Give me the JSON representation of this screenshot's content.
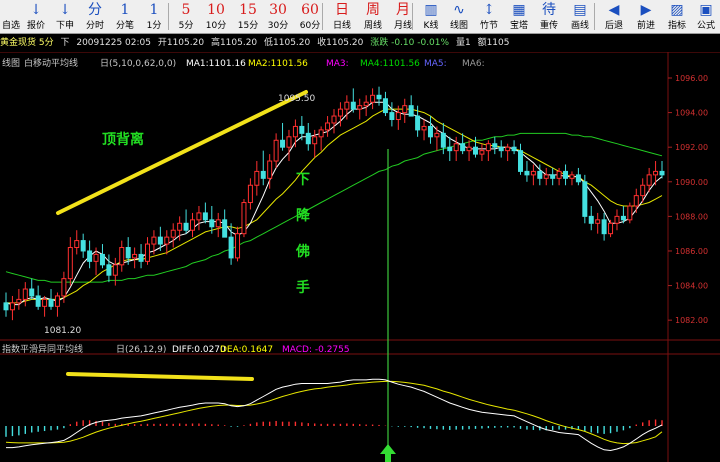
{
  "toolbar": {
    "items": [
      {
        "glyph": "",
        "label": "自选"
      },
      {
        "glyph": "↓",
        "label": "报价"
      },
      {
        "glyph": "↓",
        "label": "下申"
      },
      {
        "glyph": "分",
        "label": "分时"
      },
      {
        "glyph": "1",
        "label": "分笔"
      },
      {
        "glyph": "1",
        "label": "1分"
      },
      {
        "glyph": "5",
        "label": "5分"
      },
      {
        "glyph": "10",
        "label": "10分"
      },
      {
        "glyph": "15",
        "label": "15分"
      },
      {
        "glyph": "30",
        "label": "30分"
      },
      {
        "glyph": "60",
        "label": "60分"
      },
      {
        "glyph": "日",
        "label": "日线"
      },
      {
        "glyph": "周",
        "label": "周线"
      },
      {
        "glyph": "月",
        "label": "月线"
      },
      {
        "glyph": "▥",
        "label": "K线"
      },
      {
        "glyph": "∿",
        "label": "线图"
      },
      {
        "glyph": "↕",
        "label": "竹节"
      },
      {
        "glyph": "▦",
        "label": "宝塔"
      },
      {
        "glyph": "待",
        "label": "重传"
      },
      {
        "glyph": "▤",
        "label": "画线"
      },
      {
        "glyph": "◀",
        "label": "后退"
      },
      {
        "glyph": "▶",
        "label": "前进"
      },
      {
        "glyph": "▨",
        "label": "指标"
      },
      {
        "glyph": "▣",
        "label": "公式"
      }
    ]
  },
  "quote": {
    "name": "黄金现货 5分",
    "direction": "下",
    "time": "20091225 02:05",
    "open": "开1105.20",
    "high": "高1105.20",
    "low": "低1105.20",
    "close": "收1105.20",
    "change": "涨跌 -0.10 -0.01%",
    "volume": "量1",
    "amount": "额1105"
  },
  "legend_main": {
    "prefix": "线图",
    "name": "白移动平均线",
    "params": "日(5,10,0,62,0,0)",
    "ma1": "MA1:1101.16",
    "ma2": "MA2:1101.56",
    "ma3": "MA3:",
    "ma4": "MA4:1101.56",
    "ma5": "MA5:",
    "ma6": "MA6:"
  },
  "legend_macd": {
    "name": "指数平滑异同平均线",
    "params": "日(26,12,9)",
    "diff": "DIFF:0.0270",
    "dea": "DEA:0.1647",
    "macd": "MACD: -0.2755"
  },
  "annotations": {
    "top_divergence": "顶背离",
    "falling_hand": [
      "下",
      "降",
      "佛",
      "手"
    ],
    "high_label": "1095.50",
    "low_label": "1081.20"
  },
  "chart_data": {
    "type": "candlestick",
    "y_axis_labels": [
      "1096.00",
      "1094.00",
      "1092.00",
      "1090.00",
      "1088.00",
      "1086.00",
      "1084.00",
      "1082.00"
    ],
    "ylim": [
      1081.2,
      1096.0
    ],
    "ohlc": [
      [
        1083.0,
        1083.6,
        1082.2,
        1082.6
      ],
      [
        1082.6,
        1083.4,
        1082.0,
        1083.0
      ],
      [
        1083.0,
        1083.8,
        1082.6,
        1083.2
      ],
      [
        1083.2,
        1084.2,
        1082.8,
        1083.8
      ],
      [
        1083.8,
        1084.4,
        1083.2,
        1083.4
      ],
      [
        1083.4,
        1084.0,
        1082.6,
        1082.8
      ],
      [
        1082.8,
        1083.4,
        1082.2,
        1083.2
      ],
      [
        1083.2,
        1083.8,
        1082.6,
        1082.8
      ],
      [
        1082.8,
        1083.6,
        1082.2,
        1083.4
      ],
      [
        1083.4,
        1084.8,
        1083.0,
        1084.4
      ],
      [
        1084.4,
        1086.8,
        1084.0,
        1086.2
      ],
      [
        1086.2,
        1087.2,
        1085.8,
        1086.6
      ],
      [
        1086.6,
        1087.0,
        1085.6,
        1086.0
      ],
      [
        1086.0,
        1086.6,
        1085.0,
        1085.4
      ],
      [
        1085.4,
        1086.2,
        1084.6,
        1085.8
      ],
      [
        1085.8,
        1086.4,
        1085.0,
        1085.2
      ],
      [
        1085.2,
        1085.8,
        1084.2,
        1084.6
      ],
      [
        1084.6,
        1085.6,
        1084.0,
        1085.2
      ],
      [
        1085.2,
        1086.6,
        1084.8,
        1086.2
      ],
      [
        1086.2,
        1086.8,
        1085.2,
        1085.6
      ],
      [
        1085.6,
        1086.2,
        1085.0,
        1085.8
      ],
      [
        1085.8,
        1086.4,
        1085.0,
        1085.4
      ],
      [
        1085.4,
        1086.8,
        1085.2,
        1086.4
      ],
      [
        1086.4,
        1087.2,
        1085.8,
        1086.8
      ],
      [
        1086.8,
        1087.4,
        1086.0,
        1086.4
      ],
      [
        1086.4,
        1087.2,
        1085.8,
        1086.8
      ],
      [
        1086.8,
        1087.6,
        1086.2,
        1087.2
      ],
      [
        1087.2,
        1088.0,
        1086.6,
        1087.6
      ],
      [
        1087.6,
        1088.4,
        1087.0,
        1087.2
      ],
      [
        1087.2,
        1088.2,
        1086.8,
        1087.8
      ],
      [
        1087.8,
        1088.6,
        1087.2,
        1088.2
      ],
      [
        1088.2,
        1088.8,
        1087.6,
        1087.8
      ],
      [
        1087.8,
        1088.6,
        1087.0,
        1087.4
      ],
      [
        1087.4,
        1088.2,
        1086.8,
        1087.8
      ],
      [
        1087.8,
        1088.4,
        1087.0,
        1086.8
      ],
      [
        1086.8,
        1087.6,
        1085.2,
        1085.6
      ],
      [
        1085.6,
        1087.4,
        1085.4,
        1087.0
      ],
      [
        1087.0,
        1089.0,
        1086.8,
        1088.8
      ],
      [
        1088.8,
        1090.2,
        1088.4,
        1089.8
      ],
      [
        1089.8,
        1091.2,
        1089.2,
        1090.6
      ],
      [
        1090.6,
        1091.8,
        1089.8,
        1090.2
      ],
      [
        1090.2,
        1091.6,
        1089.6,
        1091.2
      ],
      [
        1091.2,
        1092.8,
        1090.8,
        1092.4
      ],
      [
        1092.4,
        1093.4,
        1091.8,
        1092.0
      ],
      [
        1092.0,
        1093.0,
        1091.2,
        1092.6
      ],
      [
        1092.6,
        1093.6,
        1092.0,
        1093.2
      ],
      [
        1093.2,
        1093.8,
        1092.4,
        1092.8
      ],
      [
        1092.8,
        1093.4,
        1091.8,
        1092.2
      ],
      [
        1092.2,
        1093.0,
        1091.4,
        1092.6
      ],
      [
        1092.6,
        1093.2,
        1091.8,
        1093.0
      ],
      [
        1093.0,
        1093.8,
        1092.6,
        1093.4
      ],
      [
        1093.4,
        1094.2,
        1092.8,
        1093.8
      ],
      [
        1093.8,
        1094.6,
        1093.2,
        1094.2
      ],
      [
        1094.2,
        1095.0,
        1093.6,
        1094.6
      ],
      [
        1094.6,
        1095.4,
        1094.0,
        1094.2
      ],
      [
        1094.2,
        1094.8,
        1093.6,
        1094.4
      ],
      [
        1094.4,
        1095.0,
        1093.8,
        1094.6
      ],
      [
        1094.6,
        1095.4,
        1094.2,
        1095.0
      ],
      [
        1095.0,
        1095.5,
        1094.4,
        1094.8
      ],
      [
        1094.8,
        1095.2,
        1093.8,
        1094.0
      ],
      [
        1094.0,
        1094.6,
        1093.2,
        1093.6
      ],
      [
        1093.6,
        1094.4,
        1093.0,
        1094.0
      ],
      [
        1094.0,
        1094.8,
        1093.4,
        1094.4
      ],
      [
        1094.4,
        1095.0,
        1093.8,
        1093.8
      ],
      [
        1093.8,
        1094.4,
        1092.6,
        1093.0
      ],
      [
        1093.0,
        1093.6,
        1092.4,
        1093.2
      ],
      [
        1093.2,
        1093.8,
        1092.2,
        1092.6
      ],
      [
        1092.6,
        1093.2,
        1091.8,
        1092.8
      ],
      [
        1092.8,
        1093.4,
        1091.6,
        1092.0
      ],
      [
        1092.0,
        1092.6,
        1091.2,
        1091.8
      ],
      [
        1091.8,
        1092.6,
        1091.2,
        1092.2
      ],
      [
        1092.2,
        1092.8,
        1091.6,
        1091.8
      ],
      [
        1091.8,
        1092.4,
        1091.2,
        1092.0
      ],
      [
        1092.0,
        1092.6,
        1091.4,
        1091.6
      ],
      [
        1091.6,
        1092.2,
        1091.2,
        1091.8
      ],
      [
        1091.8,
        1092.4,
        1091.2,
        1092.2
      ],
      [
        1092.2,
        1092.6,
        1091.6,
        1092.0
      ],
      [
        1092.0,
        1092.4,
        1091.4,
        1091.8
      ],
      [
        1091.8,
        1092.2,
        1091.2,
        1092.0
      ],
      [
        1092.0,
        1092.4,
        1091.6,
        1091.8
      ],
      [
        1091.8,
        1092.2,
        1090.4,
        1090.6
      ],
      [
        1090.6,
        1091.2,
        1090.0,
        1090.4
      ],
      [
        1090.4,
        1091.0,
        1089.8,
        1090.6
      ],
      [
        1090.6,
        1091.0,
        1089.8,
        1090.2
      ],
      [
        1090.2,
        1090.8,
        1089.8,
        1090.4
      ],
      [
        1090.4,
        1090.8,
        1089.8,
        1090.2
      ],
      [
        1090.2,
        1090.8,
        1089.8,
        1090.6
      ],
      [
        1090.6,
        1091.0,
        1089.8,
        1090.2
      ],
      [
        1090.2,
        1090.6,
        1089.8,
        1090.4
      ],
      [
        1090.4,
        1090.8,
        1089.8,
        1090.0
      ],
      [
        1090.0,
        1090.4,
        1087.6,
        1088.0
      ],
      [
        1088.0,
        1088.6,
        1087.2,
        1087.6
      ],
      [
        1087.6,
        1088.2,
        1087.0,
        1087.8
      ],
      [
        1087.8,
        1088.2,
        1086.6,
        1087.0
      ],
      [
        1087.0,
        1087.8,
        1086.8,
        1087.6
      ],
      [
        1087.6,
        1088.4,
        1087.2,
        1088.0
      ],
      [
        1088.0,
        1088.6,
        1087.6,
        1087.8
      ],
      [
        1087.8,
        1088.8,
        1087.6,
        1088.6
      ],
      [
        1088.6,
        1089.6,
        1088.2,
        1089.2
      ],
      [
        1089.2,
        1090.2,
        1088.8,
        1089.8
      ],
      [
        1089.8,
        1090.8,
        1089.4,
        1090.4
      ],
      [
        1090.4,
        1091.2,
        1089.8,
        1090.6
      ],
      [
        1090.6,
        1091.2,
        1090.2,
        1090.4
      ]
    ],
    "ma5": [
      1083.0,
      1082.9,
      1082.9,
      1083.2,
      1083.3,
      1083.2,
      1083.3,
      1083.2,
      1083.1,
      1083.3,
      1083.9,
      1084.6,
      1085.3,
      1085.7,
      1086.0,
      1085.8,
      1085.4,
      1085.2,
      1085.3,
      1085.4,
      1085.5,
      1085.6,
      1085.9,
      1086.0,
      1086.2,
      1086.4,
      1086.6,
      1086.9,
      1087.0,
      1087.3,
      1087.6,
      1087.7,
      1087.7,
      1087.7,
      1087.6,
      1087.1,
      1086.9,
      1087.1,
      1087.6,
      1088.4,
      1089.2,
      1090.1,
      1090.8,
      1091.3,
      1091.7,
      1092.3,
      1092.6,
      1092.6,
      1092.7,
      1092.8,
      1092.9,
      1093.2,
      1093.5,
      1093.9,
      1094.2,
      1094.2,
      1094.3,
      1094.6,
      1094.6,
      1094.6,
      1094.2,
      1094.0,
      1093.9,
      1093.9,
      1093.8,
      1093.6,
      1093.4,
      1093.0,
      1092.8,
      1092.5,
      1092.3,
      1092.1,
      1091.9,
      1091.9,
      1091.9,
      1091.9,
      1091.9,
      1092.0,
      1092.0,
      1091.9,
      1091.7,
      1091.4,
      1091.1,
      1090.7,
      1090.4,
      1090.4,
      1090.4,
      1090.3,
      1090.3,
      1090.3,
      1089.9,
      1089.4,
      1088.9,
      1088.3,
      1087.6,
      1087.6,
      1087.7,
      1087.9,
      1088.4,
      1088.9,
      1089.5,
      1090.0,
      1090.3
    ],
    "ma10": [
      1083.0,
      1083.0,
      1083.0,
      1083.1,
      1083.2,
      1083.2,
      1083.2,
      1083.2,
      1083.2,
      1083.3,
      1083.5,
      1083.7,
      1084.0,
      1084.2,
      1084.5,
      1084.8,
      1085.0,
      1085.2,
      1085.4,
      1085.5,
      1085.5,
      1085.5,
      1085.6,
      1085.7,
      1085.8,
      1085.9,
      1086.1,
      1086.3,
      1086.5,
      1086.7,
      1086.9,
      1087.1,
      1087.2,
      1087.3,
      1087.4,
      1087.4,
      1087.3,
      1087.4,
      1087.6,
      1087.8,
      1088.2,
      1088.6,
      1089.0,
      1089.3,
      1089.7,
      1090.1,
      1090.6,
      1091.0,
      1091.4,
      1091.7,
      1092.1,
      1092.4,
      1092.7,
      1092.9,
      1093.1,
      1093.3,
      1093.5,
      1093.8,
      1094.0,
      1094.2,
      1094.2,
      1094.2,
      1094.2,
      1094.2,
      1094.1,
      1094.0,
      1093.8,
      1093.5,
      1093.3,
      1093.1,
      1092.9,
      1092.7,
      1092.5,
      1092.3,
      1092.2,
      1092.1,
      1092.1,
      1092.0,
      1092.0,
      1091.9,
      1091.8,
      1091.6,
      1091.4,
      1091.2,
      1091.0,
      1090.8,
      1090.6,
      1090.4,
      1090.3,
      1090.3,
      1090.0,
      1089.8,
      1089.5,
      1089.2,
      1088.9,
      1088.7,
      1088.6,
      1088.6,
      1088.6,
      1088.7,
      1088.8,
      1089.0,
      1089.2
    ],
    "ma60": [
      1084.8,
      1084.7,
      1084.6,
      1084.5,
      1084.4,
      1084.3,
      1084.3,
      1084.2,
      1084.2,
      1084.2,
      1084.2,
      1084.2,
      1084.2,
      1084.2,
      1084.2,
      1084.2,
      1084.3,
      1084.3,
      1084.3,
      1084.4,
      1084.4,
      1084.5,
      1084.6,
      1084.6,
      1084.7,
      1084.8,
      1084.9,
      1085.0,
      1085.1,
      1085.3,
      1085.4,
      1085.5,
      1085.7,
      1085.8,
      1086.0,
      1086.1,
      1086.3,
      1086.5,
      1086.6,
      1086.8,
      1087.0,
      1087.2,
      1087.4,
      1087.6,
      1087.8,
      1088.0,
      1088.2,
      1088.4,
      1088.6,
      1088.8,
      1089.0,
      1089.2,
      1089.4,
      1089.6,
      1089.8,
      1090.0,
      1090.2,
      1090.4,
      1090.6,
      1090.7,
      1090.9,
      1091.0,
      1091.2,
      1091.3,
      1091.4,
      1091.6,
      1091.7,
      1091.8,
      1091.9,
      1092.0,
      1092.1,
      1092.2,
      1092.3,
      1092.4,
      1092.4,
      1092.5,
      1092.6,
      1092.6,
      1092.7,
      1092.7,
      1092.8,
      1092.8,
      1092.8,
      1092.8,
      1092.8,
      1092.8,
      1092.8,
      1092.8,
      1092.7,
      1092.7,
      1092.6,
      1092.6,
      1092.5,
      1092.4,
      1092.3,
      1092.2,
      1092.1,
      1092.0,
      1091.9,
      1091.8,
      1091.7,
      1091.6,
      1091.5
    ],
    "macd_hist": [
      -0.3,
      -0.28,
      -0.26,
      -0.22,
      -0.18,
      -0.16,
      -0.14,
      -0.12,
      -0.1,
      -0.06,
      0.05,
      0.12,
      0.16,
      0.16,
      0.14,
      0.12,
      0.08,
      0.06,
      0.06,
      0.06,
      0.05,
      0.05,
      0.06,
      0.06,
      0.06,
      0.06,
      0.06,
      0.07,
      0.06,
      0.07,
      0.07,
      0.06,
      0.05,
      0.04,
      0.02,
      -0.02,
      -0.02,
      0.02,
      0.06,
      0.1,
      0.12,
      0.12,
      0.14,
      0.12,
      0.12,
      0.12,
      0.1,
      0.08,
      0.07,
      0.06,
      0.06,
      0.06,
      0.06,
      0.07,
      0.06,
      0.05,
      0.04,
      0.04,
      0.03,
      0.01,
      -0.01,
      -0.02,
      -0.02,
      -0.03,
      -0.05,
      -0.06,
      -0.08,
      -0.09,
      -0.1,
      -0.11,
      -0.1,
      -0.1,
      -0.09,
      -0.08,
      -0.07,
      -0.06,
      -0.05,
      -0.04,
      -0.04,
      -0.04,
      -0.08,
      -0.1,
      -0.11,
      -0.12,
      -0.12,
      -0.11,
      -0.1,
      -0.1,
      -0.09,
      -0.09,
      -0.14,
      -0.18,
      -0.2,
      -0.22,
      -0.2,
      -0.16,
      -0.12,
      -0.06,
      0.04,
      0.1,
      0.16,
      0.18,
      0.16
    ],
    "diff": [
      -0.6,
      -0.6,
      -0.58,
      -0.55,
      -0.52,
      -0.5,
      -0.48,
      -0.46,
      -0.44,
      -0.4,
      -0.3,
      -0.18,
      -0.06,
      0.04,
      0.1,
      0.14,
      0.16,
      0.18,
      0.22,
      0.24,
      0.26,
      0.28,
      0.32,
      0.36,
      0.4,
      0.44,
      0.48,
      0.52,
      0.55,
      0.58,
      0.62,
      0.64,
      0.64,
      0.64,
      0.62,
      0.56,
      0.54,
      0.56,
      0.62,
      0.72,
      0.82,
      0.92,
      1.02,
      1.08,
      1.12,
      1.16,
      1.18,
      1.18,
      1.18,
      1.18,
      1.18,
      1.2,
      1.22,
      1.26,
      1.28,
      1.28,
      1.28,
      1.3,
      1.3,
      1.28,
      1.22,
      1.16,
      1.12,
      1.08,
      1.02,
      0.96,
      0.88,
      0.8,
      0.72,
      0.64,
      0.58,
      0.52,
      0.46,
      0.42,
      0.38,
      0.36,
      0.34,
      0.32,
      0.3,
      0.28,
      0.2,
      0.12,
      0.04,
      -0.04,
      -0.1,
      -0.14,
      -0.18,
      -0.2,
      -0.22,
      -0.24,
      -0.36,
      -0.48,
      -0.58,
      -0.66,
      -0.68,
      -0.64,
      -0.58,
      -0.48,
      -0.36,
      -0.24,
      -0.14,
      -0.06,
      0.03
    ],
    "dea": [
      -0.45,
      -0.46,
      -0.47,
      -0.47,
      -0.47,
      -0.47,
      -0.47,
      -0.47,
      -0.46,
      -0.45,
      -0.42,
      -0.37,
      -0.31,
      -0.24,
      -0.17,
      -0.11,
      -0.06,
      -0.02,
      0.02,
      0.06,
      0.1,
      0.13,
      0.17,
      0.21,
      0.25,
      0.29,
      0.33,
      0.37,
      0.41,
      0.45,
      0.49,
      0.52,
      0.55,
      0.57,
      0.58,
      0.58,
      0.57,
      0.57,
      0.58,
      0.61,
      0.65,
      0.7,
      0.76,
      0.82,
      0.87,
      0.92,
      0.96,
      1.0,
      1.03,
      1.05,
      1.08,
      1.1,
      1.12,
      1.14,
      1.17,
      1.19,
      1.2,
      1.22,
      1.23,
      1.24,
      1.24,
      1.23,
      1.21,
      1.19,
      1.16,
      1.13,
      1.08,
      1.03,
      0.97,
      0.92,
      0.86,
      0.8,
      0.74,
      0.69,
      0.64,
      0.59,
      0.55,
      0.51,
      0.47,
      0.44,
      0.39,
      0.34,
      0.28,
      0.22,
      0.15,
      0.09,
      0.03,
      -0.02,
      -0.06,
      -0.1,
      -0.15,
      -0.22,
      -0.29,
      -0.37,
      -0.43,
      -0.47,
      -0.49,
      -0.48,
      -0.46,
      -0.41,
      -0.36,
      -0.3,
      -0.16
    ]
  }
}
